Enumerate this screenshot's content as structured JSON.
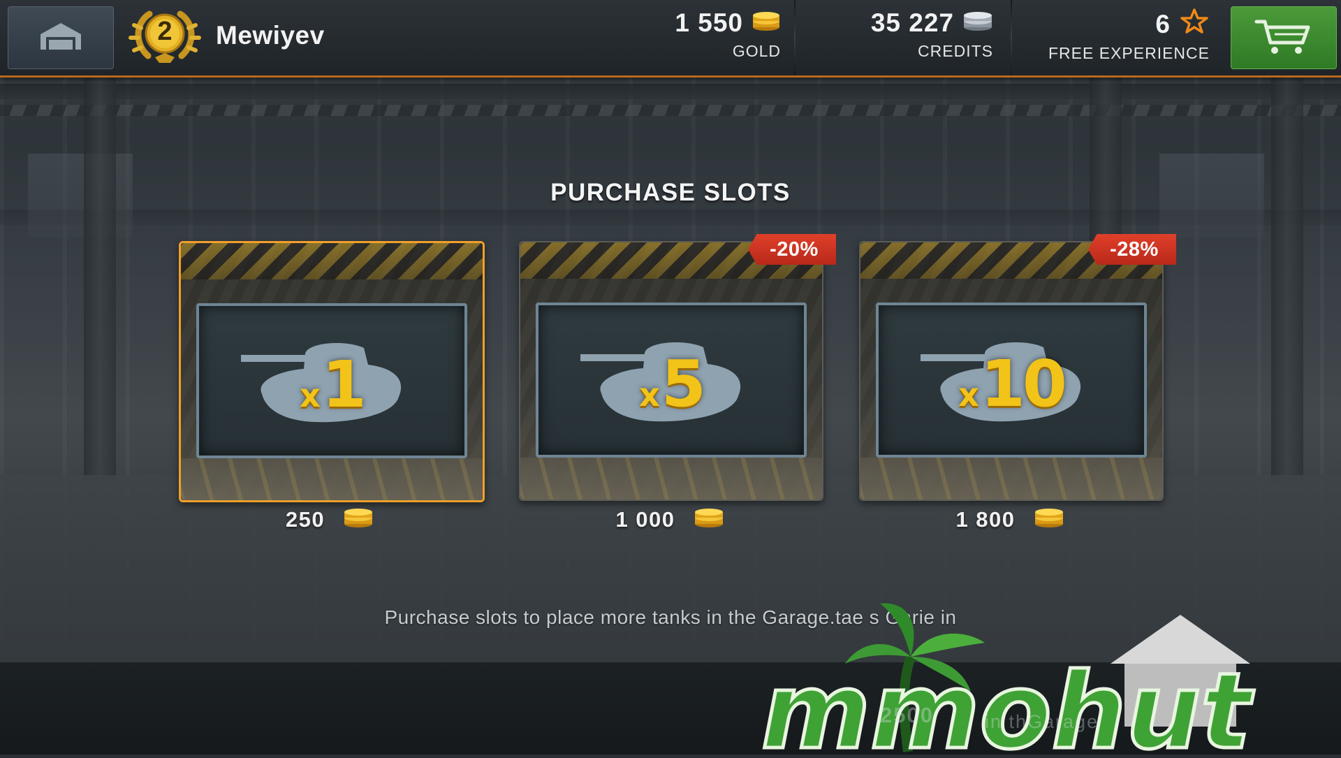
{
  "player": {
    "rank": "2",
    "name": "Mewiyev"
  },
  "currencies": [
    {
      "amount": "1 550",
      "label": "GOLD",
      "icon": "gold-coins-icon"
    },
    {
      "amount": "35 227",
      "label": "CREDITS",
      "icon": "silver-credits-icon"
    },
    {
      "amount": "6",
      "label": "FREE EXPERIENCE",
      "icon": "star-icon"
    }
  ],
  "buttons": {
    "home_icon": "hangar-home-icon",
    "cart_icon": "shopping-cart-icon"
  },
  "section": {
    "title": "PURCHASE SLOTS"
  },
  "slots": [
    {
      "x_label": "x",
      "multiplier": "1",
      "price": "250",
      "discount": "",
      "selected": true
    },
    {
      "x_label": "x",
      "multiplier": "5",
      "price": "1 000",
      "discount": "-20%",
      "selected": false
    },
    {
      "x_label": "x",
      "multiplier": "10",
      "price": "1 800",
      "discount": "-28%",
      "selected": false
    }
  ],
  "description": "Purchase slots to place more tanks in the Garage.tae  s Garie in",
  "watermark": {
    "brand": "mmohut",
    "ghost_amount": "2500",
    "ghost_text": "in thGarage"
  },
  "colors": {
    "accent_orange": "#f0a02a",
    "gold": "#f2c318",
    "discount_red": "#d0321f",
    "cart_green": "#3d8a2f"
  }
}
